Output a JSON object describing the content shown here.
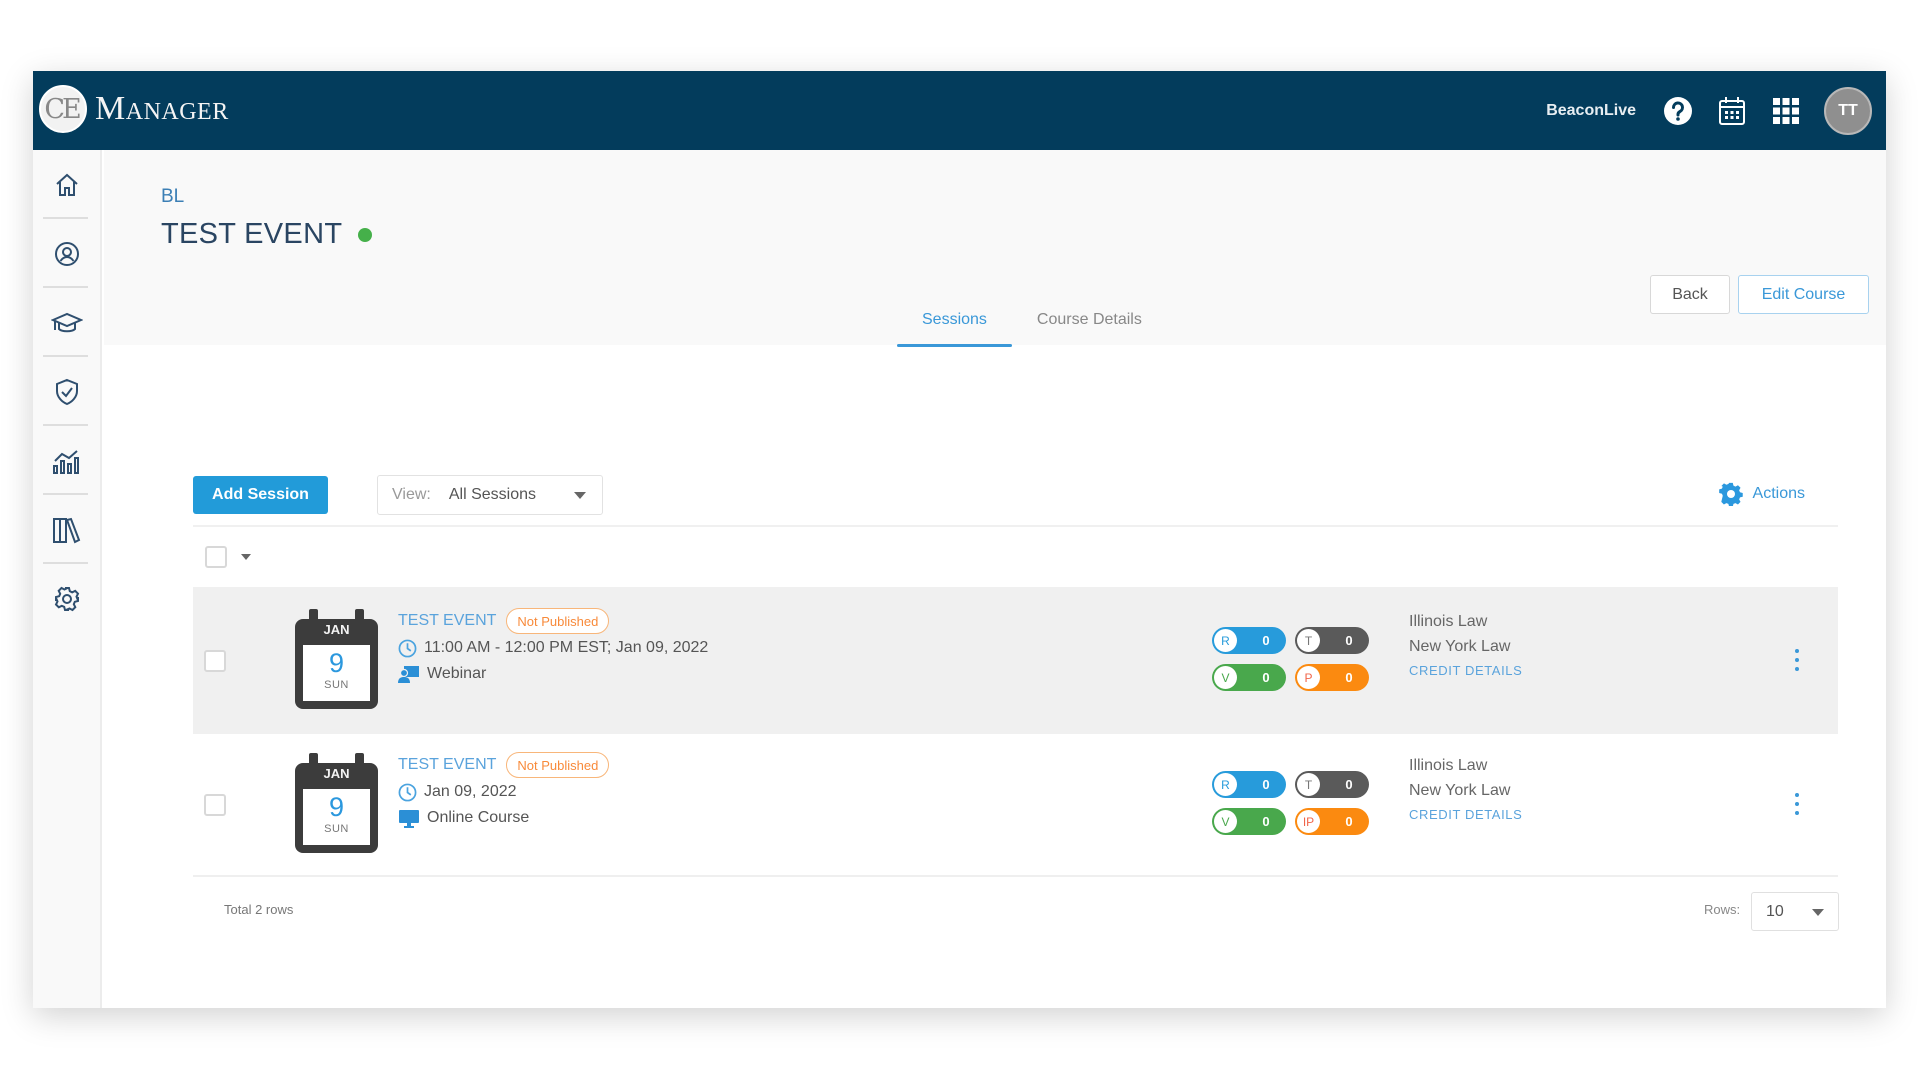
{
  "header": {
    "logo_mark": "CE",
    "logo_text": "Manager",
    "org_name": "BeaconLive",
    "avatar_initials": "TT",
    "icons": [
      "help-icon",
      "calendar-icon",
      "apps-grid-icon"
    ]
  },
  "sidebar": {
    "items": [
      {
        "name": "home",
        "icon": "home-icon"
      },
      {
        "name": "users",
        "icon": "user-circle-icon"
      },
      {
        "name": "courses",
        "icon": "graduation-cap-icon"
      },
      {
        "name": "compliance",
        "icon": "shield-check-icon"
      },
      {
        "name": "reports",
        "icon": "analytics-icon"
      },
      {
        "name": "library",
        "icon": "library-icon"
      },
      {
        "name": "settings",
        "icon": "gear-icon"
      }
    ]
  },
  "page": {
    "breadcrumb": "BL",
    "title": "TEST EVENT",
    "status_color": "#45b04a",
    "back_label": "Back",
    "edit_label": "Edit Course"
  },
  "tabs": [
    {
      "label": "Sessions",
      "active": true
    },
    {
      "label": "Course Details",
      "active": false
    }
  ],
  "toolbar": {
    "add_label": "Add Session",
    "view_label": "View:",
    "view_value": "All Sessions",
    "actions_label": "Actions"
  },
  "sessions": [
    {
      "cal_month": "JAN",
      "cal_day": "9",
      "cal_dow": "SUN",
      "title": "TEST EVENT",
      "badge": "Not Published",
      "time": "11:00 AM - 12:00 PM  EST; Jan 09, 2022",
      "type": "Webinar",
      "type_icon": "webinar-icon",
      "pills": {
        "r_label": "R",
        "r_count": "0",
        "t_label": "T",
        "t_count": "0",
        "v_label": "V",
        "v_count": "0",
        "p_label": "P",
        "p_count": "0"
      },
      "credits": [
        "Illinois Law",
        "New York Law"
      ],
      "credit_link": "CREDIT DETAILS"
    },
    {
      "cal_month": "JAN",
      "cal_day": "9",
      "cal_dow": "SUN",
      "title": "TEST EVENT",
      "badge": "Not Published",
      "time": "Jan 09, 2022",
      "type": "Online Course",
      "type_icon": "monitor-icon",
      "pills": {
        "r_label": "R",
        "r_count": "0",
        "t_label": "T",
        "t_count": "0",
        "v_label": "V",
        "v_count": "0",
        "p_label": "IP",
        "p_count": "0"
      },
      "credits": [
        "Illinois Law",
        "New York Law"
      ],
      "credit_link": "CREDIT DETAILS"
    }
  ],
  "footer": {
    "total": "Total 2 rows",
    "rows_label": "Rows:",
    "rows_value": "10"
  }
}
